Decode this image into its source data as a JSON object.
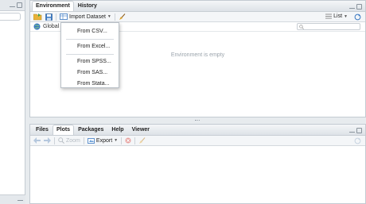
{
  "env_pane": {
    "tabs": [
      "Environment",
      "History"
    ],
    "toolbar": {
      "import_label": "Import Dataset",
      "list_label": "List"
    },
    "scope_label": "Global",
    "empty_message": "Environment is empty"
  },
  "import_menu": {
    "items": [
      "From CSV...",
      "From Excel...",
      "From SPSS...",
      "From SAS...",
      "From Stata..."
    ]
  },
  "files_pane": {
    "tabs": [
      "Files",
      "Plots",
      "Packages",
      "Help",
      "Viewer"
    ],
    "toolbar": {
      "zoom_label": "Zoom",
      "export_label": "Export"
    }
  },
  "colors": {
    "accent_blue": "#3a78c2",
    "folder_yellow": "#e8b339",
    "broom": "#d9a02a",
    "delete_red": "#d9534f"
  }
}
